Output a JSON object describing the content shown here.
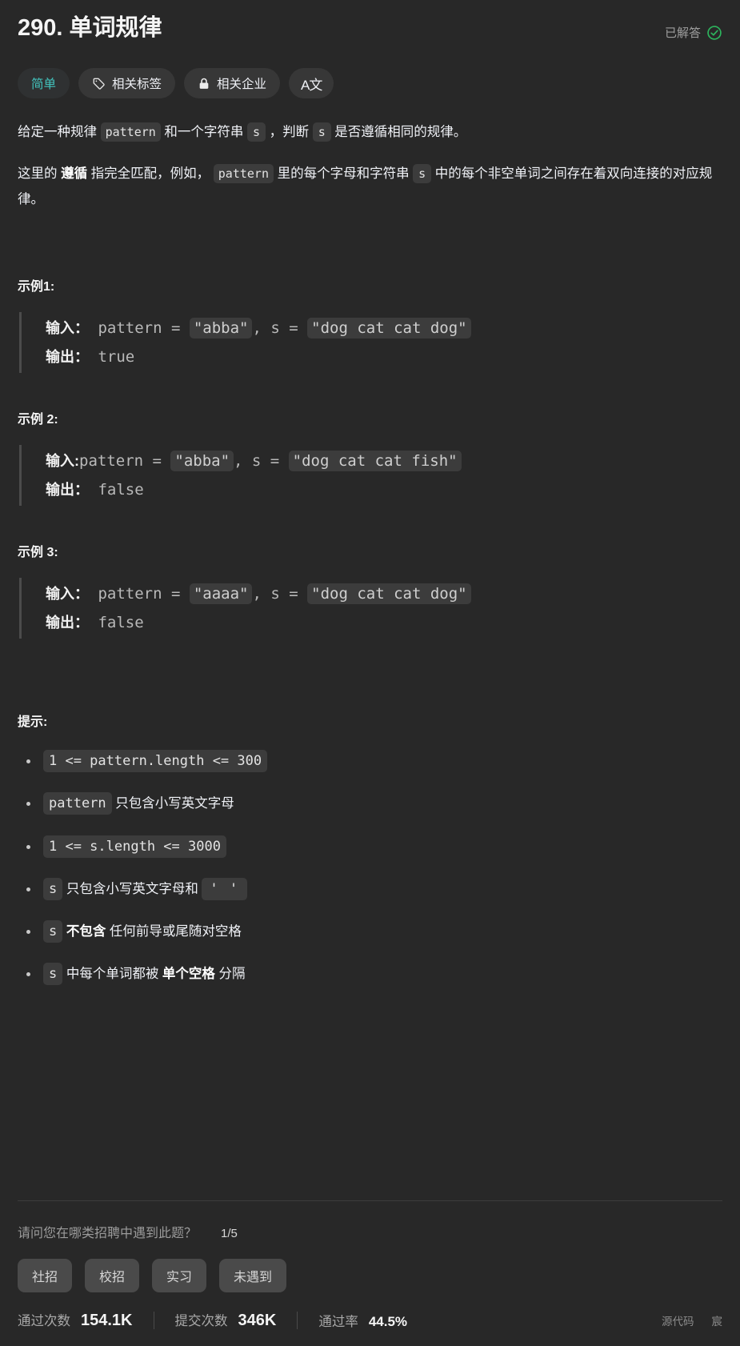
{
  "header": {
    "title": "290. 单词规律",
    "status_label": "已解答",
    "status_icon": "check-circle-icon",
    "status_color": "#2db55d"
  },
  "tags": [
    {
      "label": "简单",
      "icon": null,
      "name": "difficulty-pill"
    },
    {
      "label": "相关标签",
      "icon": "tag-icon",
      "name": "related-topics-pill"
    },
    {
      "label": "相关企业",
      "icon": "lock-icon",
      "name": "related-companies-pill"
    },
    {
      "label": "A文",
      "icon": "translate-icon",
      "name": "translate-pill"
    }
  ],
  "description": {
    "p1_a": "给定一种规律 ",
    "p1_code1": "pattern",
    "p1_b": " 和一个字符串 ",
    "p1_code2": "s",
    "p1_c": " ，判断 ",
    "p1_code3": "s",
    "p1_d": " 是否遵循相同的规律。",
    "p2_a": "这里的 ",
    "p2_bold": "遵循",
    "p2_b": " 指完全匹配，例如， ",
    "p2_code1": "pattern",
    "p2_c": " 里的每个字母和字符串 ",
    "p2_code2": "s",
    "p2_d": " 中的每个非空单词之间存在着双向连接的对应规律。"
  },
  "examples": [
    {
      "heading": "示例1:",
      "input_label": "输入：",
      "input_pre": " pattern = ",
      "input_code1": "\"abba\"",
      "input_mid": ", s = ",
      "input_code2": "\"dog cat cat dog\"",
      "output_label": "输出：",
      "output_value": " true"
    },
    {
      "heading": "示例 2:",
      "input_label": "输入:",
      "input_pre": "pattern = ",
      "input_code1": "\"abba\"",
      "input_mid": ", s = ",
      "input_code2": "\"dog cat cat fish\"",
      "output_label": "输出：",
      "output_value": " false"
    },
    {
      "heading": "示例 3:",
      "input_label": "输入：",
      "input_pre": " pattern = ",
      "input_code1": "\"aaaa\"",
      "input_mid": ", s = ",
      "input_code2": "\"dog cat cat dog\"",
      "output_label": "输出：",
      "output_value": " false"
    }
  ],
  "hints": {
    "heading": "提示:",
    "items": [
      {
        "code": "1 <= pattern.length <= 300",
        "text": "",
        "bold": "",
        "tail": ""
      },
      {
        "code": "pattern",
        "text": " 只包含小写英文字母",
        "bold": "",
        "tail": ""
      },
      {
        "code": "1 <= s.length <= 3000",
        "text": "",
        "bold": "",
        "tail": ""
      },
      {
        "code": "s",
        "text": " 只包含小写英文字母和 ",
        "code2": "' '",
        "bold": "",
        "tail": ""
      },
      {
        "code": "s",
        "text": " ",
        "bold": "不包含",
        "tail": " 任何前导或尾随对空格"
      },
      {
        "code": "s",
        "text": " 中每个单词都被 ",
        "bold": "单个空格",
        "tail": " 分隔"
      }
    ]
  },
  "survey": {
    "question": "请问您在哪类招聘中遇到此题？",
    "counter": "1/5",
    "options": [
      "社招",
      "校招",
      "实习",
      "未遇到"
    ]
  },
  "footer": {
    "stats": [
      {
        "label": "通过次数",
        "value": "154.1K"
      },
      {
        "label": "提交次数",
        "value": "346K"
      },
      {
        "label": "通过率",
        "value": "44.5%"
      }
    ],
    "source_label": "源代码",
    "author_label": "宸"
  }
}
